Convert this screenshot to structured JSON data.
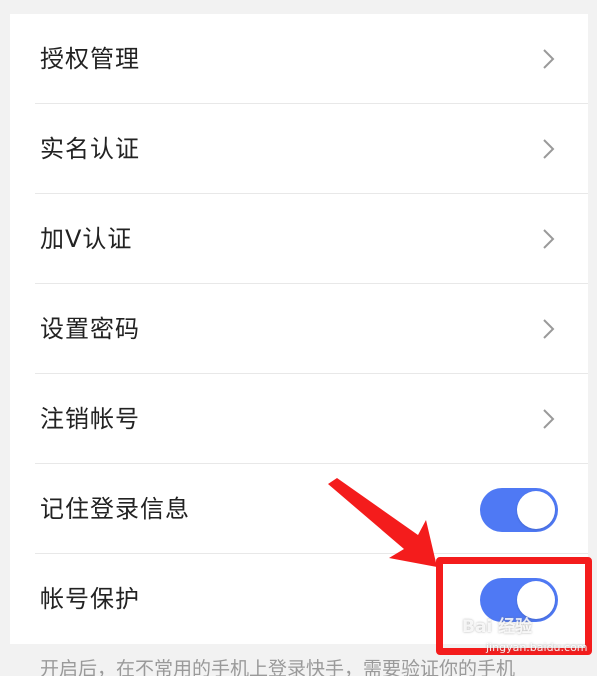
{
  "settings": {
    "items": [
      {
        "label": "授权管理",
        "control": "chevron-right-icon"
      },
      {
        "label": "实名认证",
        "control": "chevron-right-icon"
      },
      {
        "label": "加V认证",
        "control": "chevron-right-icon"
      },
      {
        "label": "设置密码",
        "control": "chevron-right-icon"
      },
      {
        "label": "注销帐号",
        "control": "chevron-right-icon"
      },
      {
        "label": "记住登录信息",
        "control": "toggle",
        "on": true
      },
      {
        "label": "帐号保护",
        "control": "toggle",
        "on": true
      }
    ],
    "footer_note": "开启后，在不常用的手机上登录快手，需要验证你的手机"
  },
  "annotation": {
    "arrow_color": "#f41c1c",
    "box_color": "#f41c1c"
  },
  "watermark": {
    "brand": "Bai 经验",
    "url": "jingyan.baidu.com"
  },
  "colors": {
    "toggle_on": "#4f79f4",
    "background": "#f2f2f2",
    "card": "#ffffff"
  }
}
